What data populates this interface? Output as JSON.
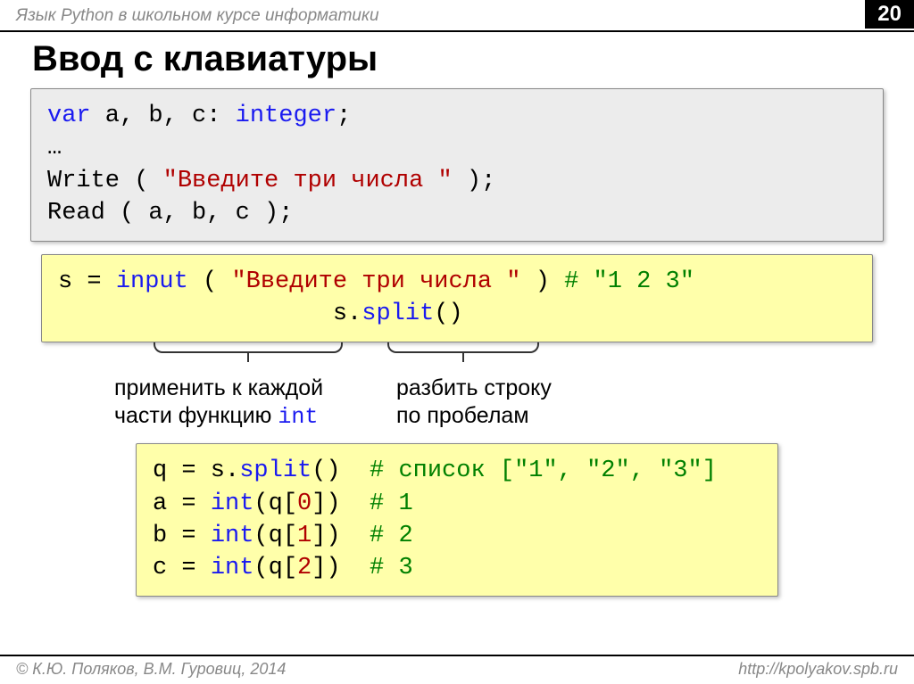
{
  "header": {
    "subject": "Язык Python в школьном курсе информатики",
    "page": "20"
  },
  "title": "Ввод с клавиатуры",
  "pascal": {
    "l1_a": "var",
    "l1_b": " a, b, c: ",
    "l1_c": "integer",
    "l1_d": ";",
    "l2": "…",
    "l3_a": "Write ( ",
    "l3_b": "\"Введите три числа \"",
    "l3_c": " );",
    "l4": "Read ( a, b, c );"
  },
  "py1": {
    "l1_a": "s = ",
    "l1_b": "input",
    "l1_c": " ( ",
    "l1_d": "\"Введите три числа \"",
    "l1_e": " ) ",
    "l1_f": "# \"1 2 3\"",
    "l2_pad": "                   ",
    "l2_a": "s.",
    "l2_b": "split",
    "l2_c": "()"
  },
  "anno": {
    "left_l1": "применить к каждой",
    "left_l2a": "части функцию ",
    "left_l2b": "int",
    "right_l1": "разбить строку",
    "right_l2": "по пробелам"
  },
  "py2": {
    "l1_a": "q = s.",
    "l1_b": "split",
    "l1_c": "()  ",
    "l1_d": "# список [\"1\", \"2\", \"3\"]",
    "l2_a": "a = ",
    "l2_b": "int",
    "l2_c": "(q[",
    "l2_d": "0",
    "l2_e": "])  ",
    "l2_f": "# 1",
    "l3_a": "b = ",
    "l3_b": "int",
    "l3_c": "(q[",
    "l3_d": "1",
    "l3_e": "])  ",
    "l3_f": "# 2",
    "l4_a": "c = ",
    "l4_b": "int",
    "l4_c": "(q[",
    "l4_d": "2",
    "l4_e": "])  ",
    "l4_f": "# 3"
  },
  "footer": {
    "left": "© К.Ю. Поляков, В.М. Гуровиц, 2014",
    "right": "http://kpolyakov.spb.ru"
  }
}
